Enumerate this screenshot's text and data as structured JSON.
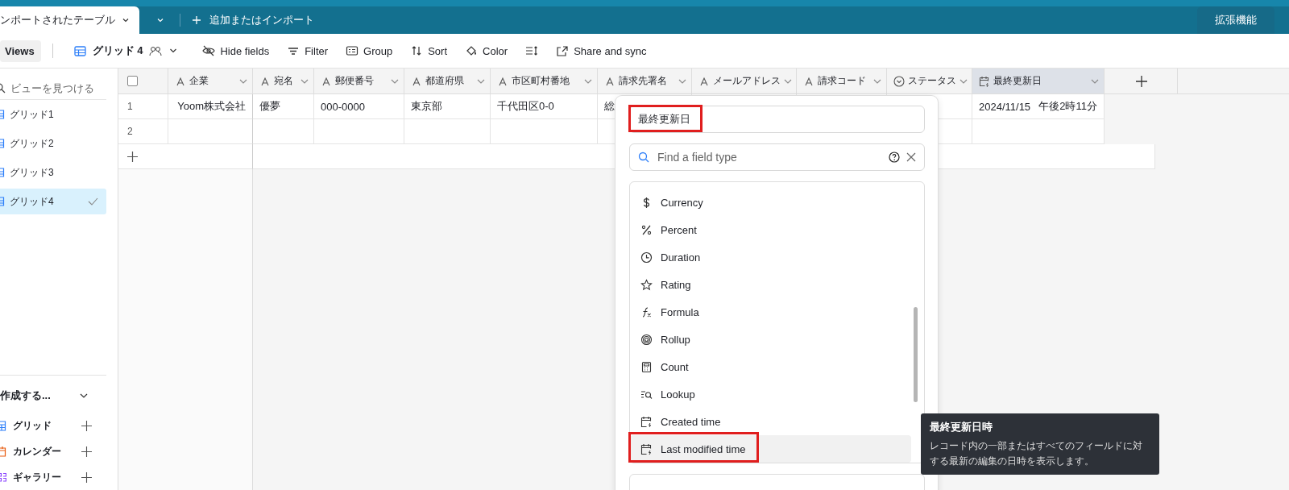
{
  "top_bar": {
    "active_tab": "ンポートされたテーブル",
    "add_import": "追加またはインポート",
    "extensions": "拡張機能"
  },
  "toolbar": {
    "views": "Views",
    "view_name": "グリッド 4",
    "actions": [
      {
        "kind": "hide",
        "label": "Hide fields"
      },
      {
        "kind": "filter",
        "label": "Filter"
      },
      {
        "kind": "group",
        "label": "Group"
      },
      {
        "kind": "sort",
        "label": "Sort"
      },
      {
        "kind": "color",
        "label": "Color"
      },
      {
        "kind": "rowheight"
      },
      {
        "kind": "share",
        "label": "Share and sync"
      }
    ]
  },
  "sidebar": {
    "search_placeholder": "ビューを見つける",
    "views": [
      {
        "label": "グリッド1",
        "selected": false
      },
      {
        "label": "グリッド2",
        "selected": false
      },
      {
        "label": "グリッド3",
        "selected": false
      },
      {
        "label": "グリッド4",
        "selected": true
      }
    ],
    "create": {
      "title": "作成する...",
      "items": [
        {
          "kind": "grid",
          "label": "グリッド"
        },
        {
          "kind": "calendar",
          "label": "カレンダー"
        },
        {
          "kind": "gallery",
          "label": "ギャラリー"
        }
      ]
    }
  },
  "table": {
    "select_all": {
      "checked": false
    },
    "columns": [
      {
        "kind": "text",
        "label": "企業",
        "selected": false
      },
      {
        "kind": "text",
        "label": "宛名",
        "selected": false
      },
      {
        "kind": "text",
        "label": "郵便番号",
        "selected": false
      },
      {
        "kind": "text",
        "label": "都道府県",
        "selected": false
      },
      {
        "kind": "text",
        "label": "市区町村番地",
        "selected": false
      },
      {
        "kind": "text",
        "label": "請求先署名",
        "selected": false
      },
      {
        "kind": "text",
        "label": "メールアドレス",
        "selected": false
      },
      {
        "kind": "text",
        "label": "請求コード",
        "selected": false
      },
      {
        "kind": "status",
        "label": "ステータス",
        "selected": false
      },
      {
        "kind": "date",
        "label": "最終更新日",
        "selected": true
      }
    ],
    "rows": [
      {
        "number": "1",
        "cells": [
          "Yoom株式会社",
          "優夢",
          "000-0000",
          "東京部",
          "千代田区0-0",
          "総"
        ],
        "last_modified": {
          "date": "2024/11/15",
          "time": "午後2時11分"
        }
      },
      {
        "number": "2",
        "cells": []
      }
    ]
  },
  "field_editor": {
    "name_field": {
      "value": "最終更新日",
      "annotated": true
    },
    "search_placeholder": "Find a field type",
    "types": [
      {
        "kind": "currency",
        "label": "Currency",
        "highlighted": false,
        "annotated": false
      },
      {
        "kind": "percent",
        "label": "Percent",
        "highlighted": false,
        "annotated": false
      },
      {
        "kind": "duration",
        "label": "Duration",
        "highlighted": false,
        "annotated": false
      },
      {
        "kind": "rating",
        "label": "Rating",
        "highlighted": false,
        "annotated": false
      },
      {
        "kind": "formula",
        "label": "Formula",
        "highlighted": false,
        "annotated": false
      },
      {
        "kind": "rollup",
        "label": "Rollup",
        "highlighted": false,
        "annotated": false
      },
      {
        "kind": "count",
        "label": "Count",
        "highlighted": false,
        "annotated": false
      },
      {
        "kind": "lookup",
        "label": "Lookup",
        "highlighted": false,
        "annotated": false
      },
      {
        "kind": "created",
        "label": "Created time",
        "highlighted": false,
        "annotated": false
      },
      {
        "kind": "modified",
        "label": "Last modified time",
        "highlighted": true,
        "annotated": true
      }
    ]
  },
  "tooltip": {
    "title": "最終更新日時",
    "description": "レコード内の一部またはすべてのフィールドに対する最新の編集の日時を表示します。"
  }
}
